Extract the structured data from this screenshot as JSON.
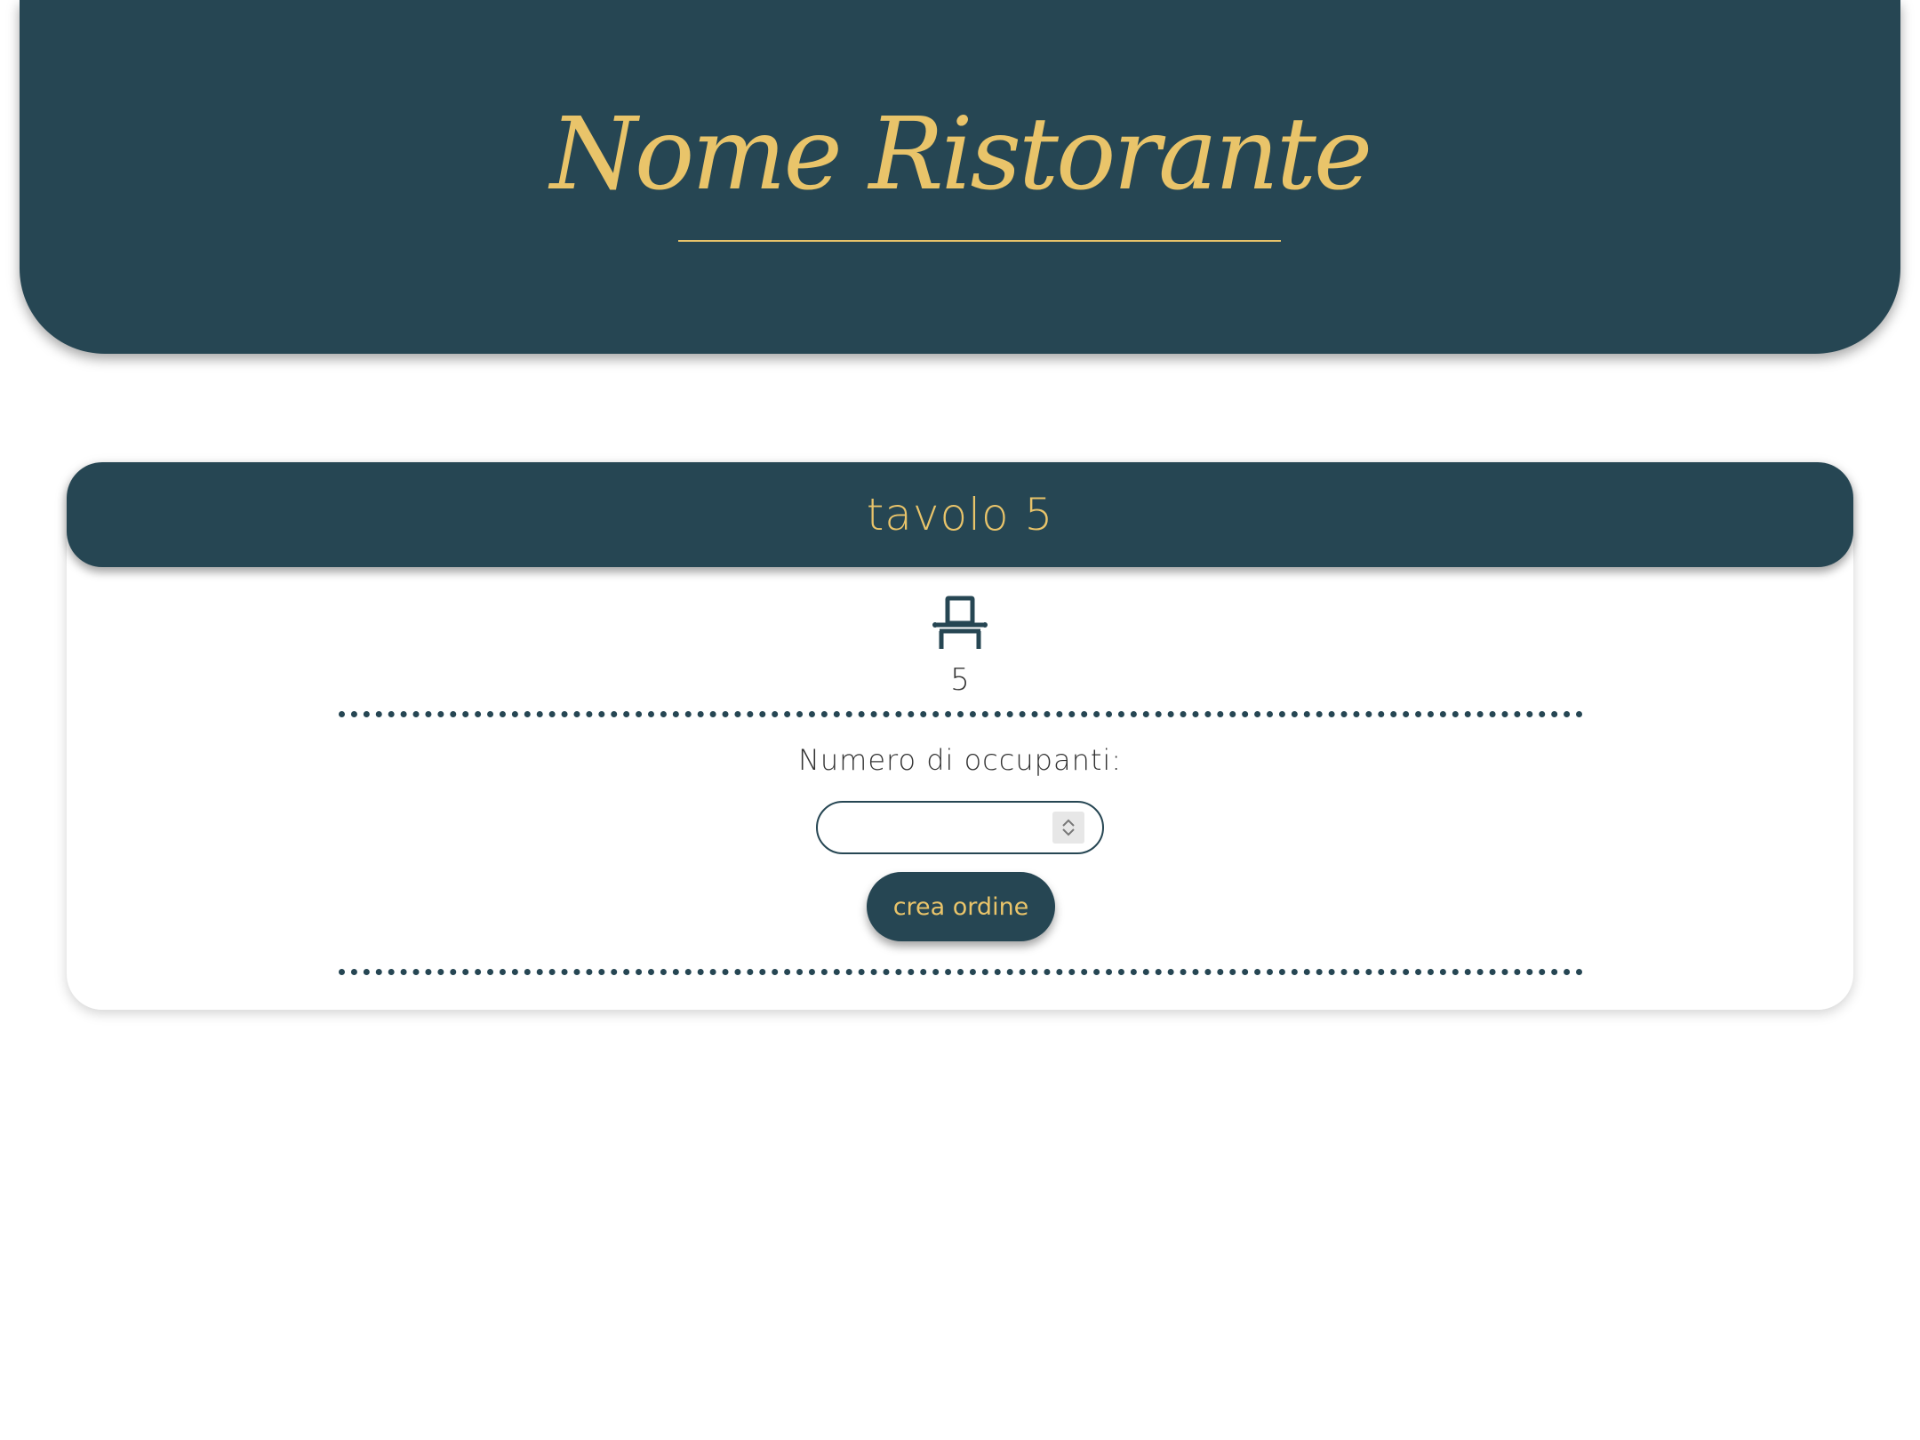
{
  "header": {
    "restaurant_name": "Nome Ristorante"
  },
  "table_card": {
    "title": "tavolo 5",
    "chair_icon": "chair-icon",
    "seats": "5",
    "occupants_label": "Numero di occupanti:",
    "occupants_value": "",
    "create_order_label": "crea ordine"
  },
  "colors": {
    "primary": "#264653",
    "accent": "#e9c46a",
    "background": "#ffffff"
  }
}
